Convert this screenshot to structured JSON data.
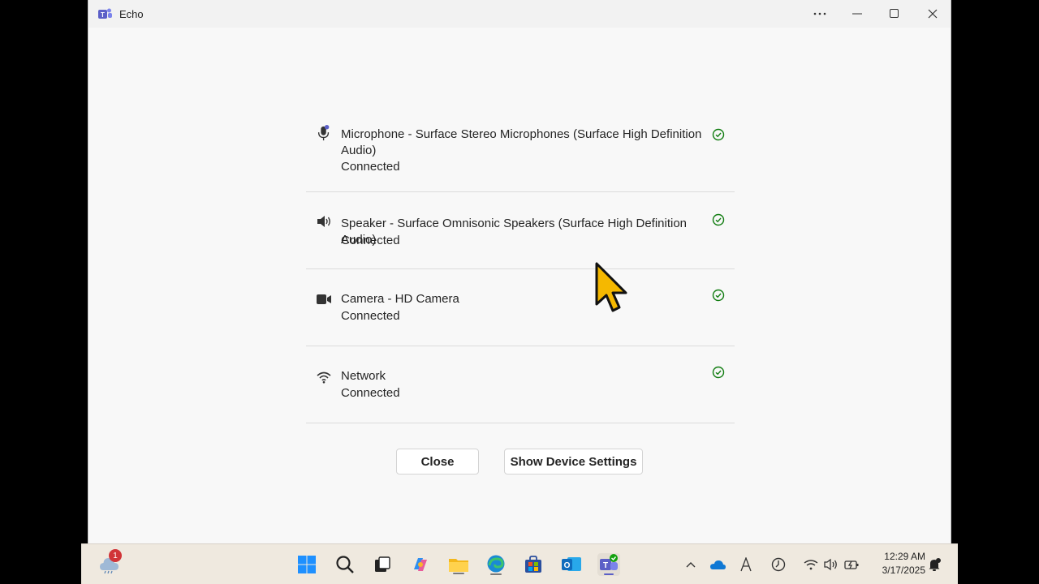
{
  "window": {
    "title": "Echo",
    "controls": {
      "more": "more-options",
      "minimize": "minimize",
      "maximize": "maximize",
      "close": "close"
    }
  },
  "devices": [
    {
      "name": "Microphone - Surface Stereo Microphones (Surface High Definition Audio)",
      "status": "Connected",
      "icon": "microphone-icon"
    },
    {
      "name": "Speaker - Surface Omnisonic Speakers (Surface High Definition Audio)",
      "status": "Connected",
      "icon": "speaker-icon"
    },
    {
      "name": "Camera - HD Camera",
      "status": "Connected",
      "icon": "camera-icon"
    },
    {
      "name": "Network",
      "status": "Connected",
      "icon": "wifi-icon"
    }
  ],
  "buttons": {
    "close": "Close",
    "settings": "Show Device Settings"
  },
  "colors": {
    "check": "#107c10",
    "accent_teams": "#5b5fc7",
    "badge": "#d13438"
  },
  "taskbar": {
    "weather_badge": "1",
    "clock": {
      "time": "12:29 AM",
      "date": "3/17/2025"
    }
  }
}
